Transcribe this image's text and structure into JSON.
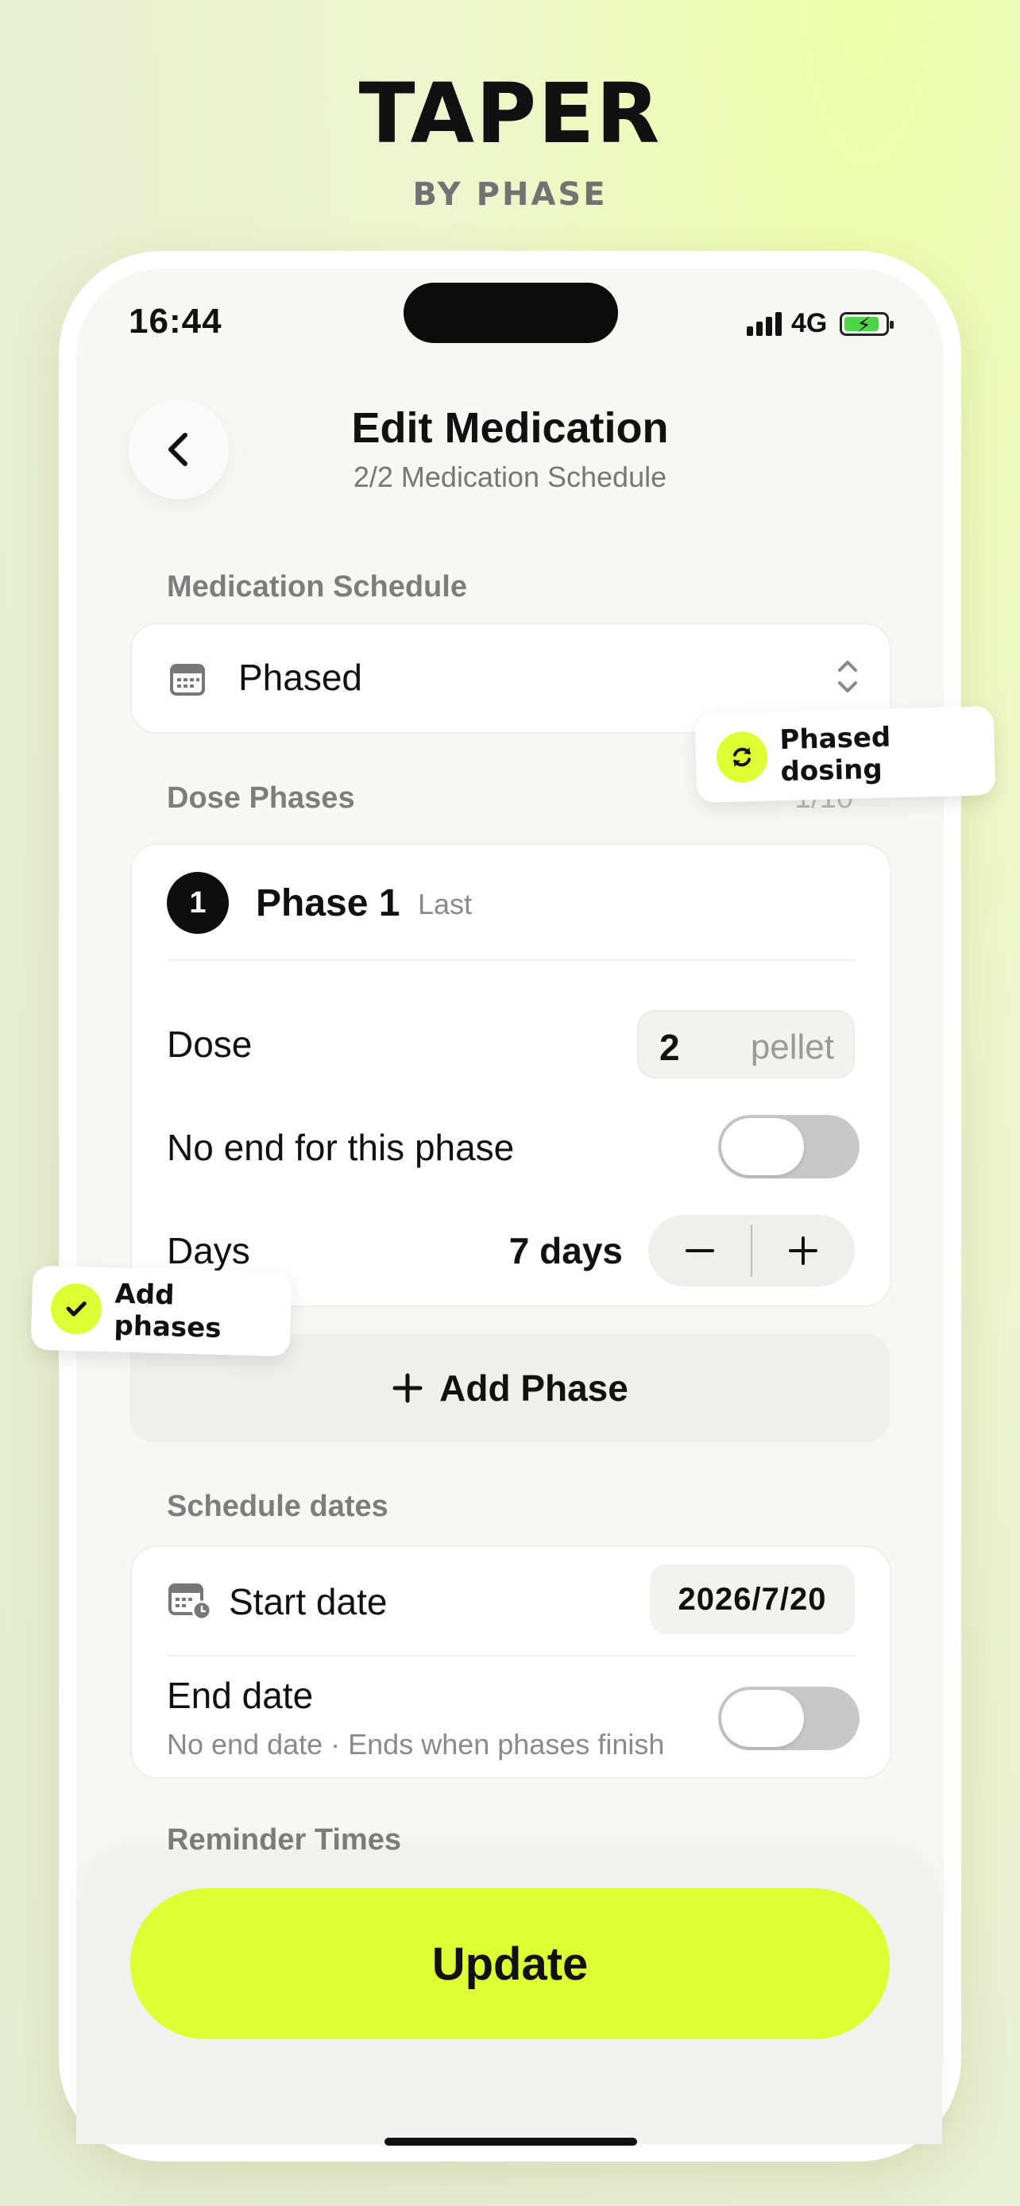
{
  "promo": {
    "title": "TAPER",
    "subtitle": "BY PHASE"
  },
  "status_bar": {
    "time": "16:44",
    "network": "4G"
  },
  "header": {
    "title": "Edit Medication",
    "subtitle": "2/2 Medication Schedule"
  },
  "medication_schedule": {
    "label": "Medication Schedule",
    "value": "Phased"
  },
  "dose_phases": {
    "label": "Dose Phases",
    "count": "1/10",
    "phases": [
      {
        "number": "1",
        "title": "Phase 1",
        "tag": "Last",
        "dose_label": "Dose",
        "dose_value": "2",
        "dose_unit": "pellet",
        "no_end_label": "No end for this phase",
        "no_end_enabled": false,
        "days_label": "Days",
        "days_value": "7 days"
      }
    ],
    "add_label": "Add Phase"
  },
  "schedule_dates": {
    "label": "Schedule dates",
    "start_label": "Start date",
    "start_value": "2026/7/20",
    "end_label": "End date",
    "end_sub": "No end date · Ends when phases finish",
    "end_enabled": false
  },
  "reminder": {
    "label": "Reminder Times"
  },
  "update_label": "Update",
  "callouts": {
    "phased": "Phased dosing",
    "add": "Add phases"
  },
  "colors": {
    "accent": "#deff33",
    "background": "#f7f7f4",
    "toggle_off": "#c8c8c8",
    "battery": "#4cd64a"
  },
  "icons": {
    "back": "chevron-left-icon",
    "calendar": "calendar-icon",
    "updown": "chevron-up-down-icon",
    "minus": "minus-icon",
    "plus": "plus-icon",
    "calendar_clock": "calendar-clock-icon",
    "refresh": "refresh-icon",
    "check": "check-icon"
  }
}
